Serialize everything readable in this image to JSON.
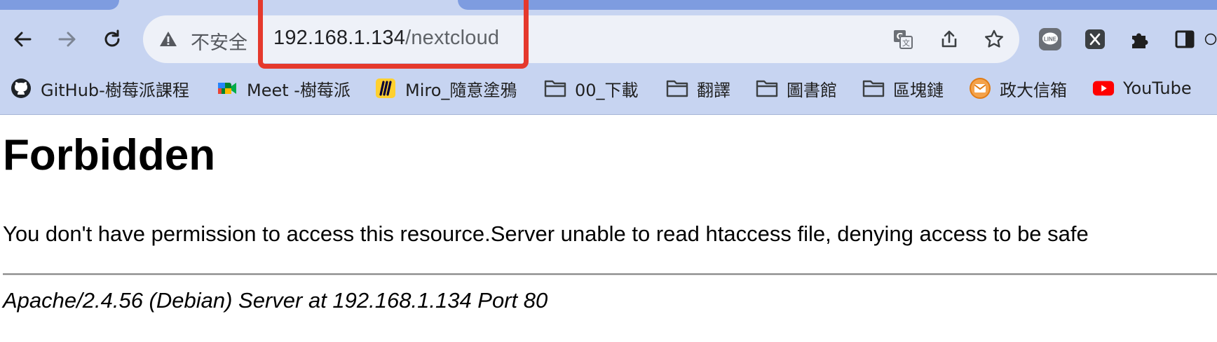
{
  "browser": {
    "security_label": "不安全",
    "url_host": "192.168.1.134",
    "url_path": "/nextcloud",
    "icons": [
      "back-icon",
      "forward-icon",
      "reload-icon",
      "warning-icon",
      "translate-icon",
      "share-icon",
      "star-icon",
      "line-icon",
      "x-icon",
      "puzzle-icon",
      "sidepanel-icon"
    ],
    "accent_highlight_color": "#e5392d"
  },
  "bookmarks": [
    {
      "label": "GitHub-樹莓派課程",
      "icon": "github-icon"
    },
    {
      "label": "Meet -樹莓派",
      "icon": "meet-icon"
    },
    {
      "label": "Miro_隨意塗鴉",
      "icon": "miro-icon"
    },
    {
      "label": "00_下載",
      "icon": "folder-icon"
    },
    {
      "label": "翻譯",
      "icon": "folder-icon"
    },
    {
      "label": "圖書館",
      "icon": "folder-icon"
    },
    {
      "label": "區塊鏈",
      "icon": "folder-icon"
    },
    {
      "label": "政大信箱",
      "icon": "mail-icon"
    },
    {
      "label": "YouTube",
      "icon": "youtube-icon"
    }
  ],
  "page": {
    "title": "Forbidden",
    "message": "You don't have permission to access this resource.Server unable to read htaccess file, denying access to be safe",
    "signature": "Apache/2.4.56 (Debian) Server at 192.168.1.134 Port 80"
  }
}
